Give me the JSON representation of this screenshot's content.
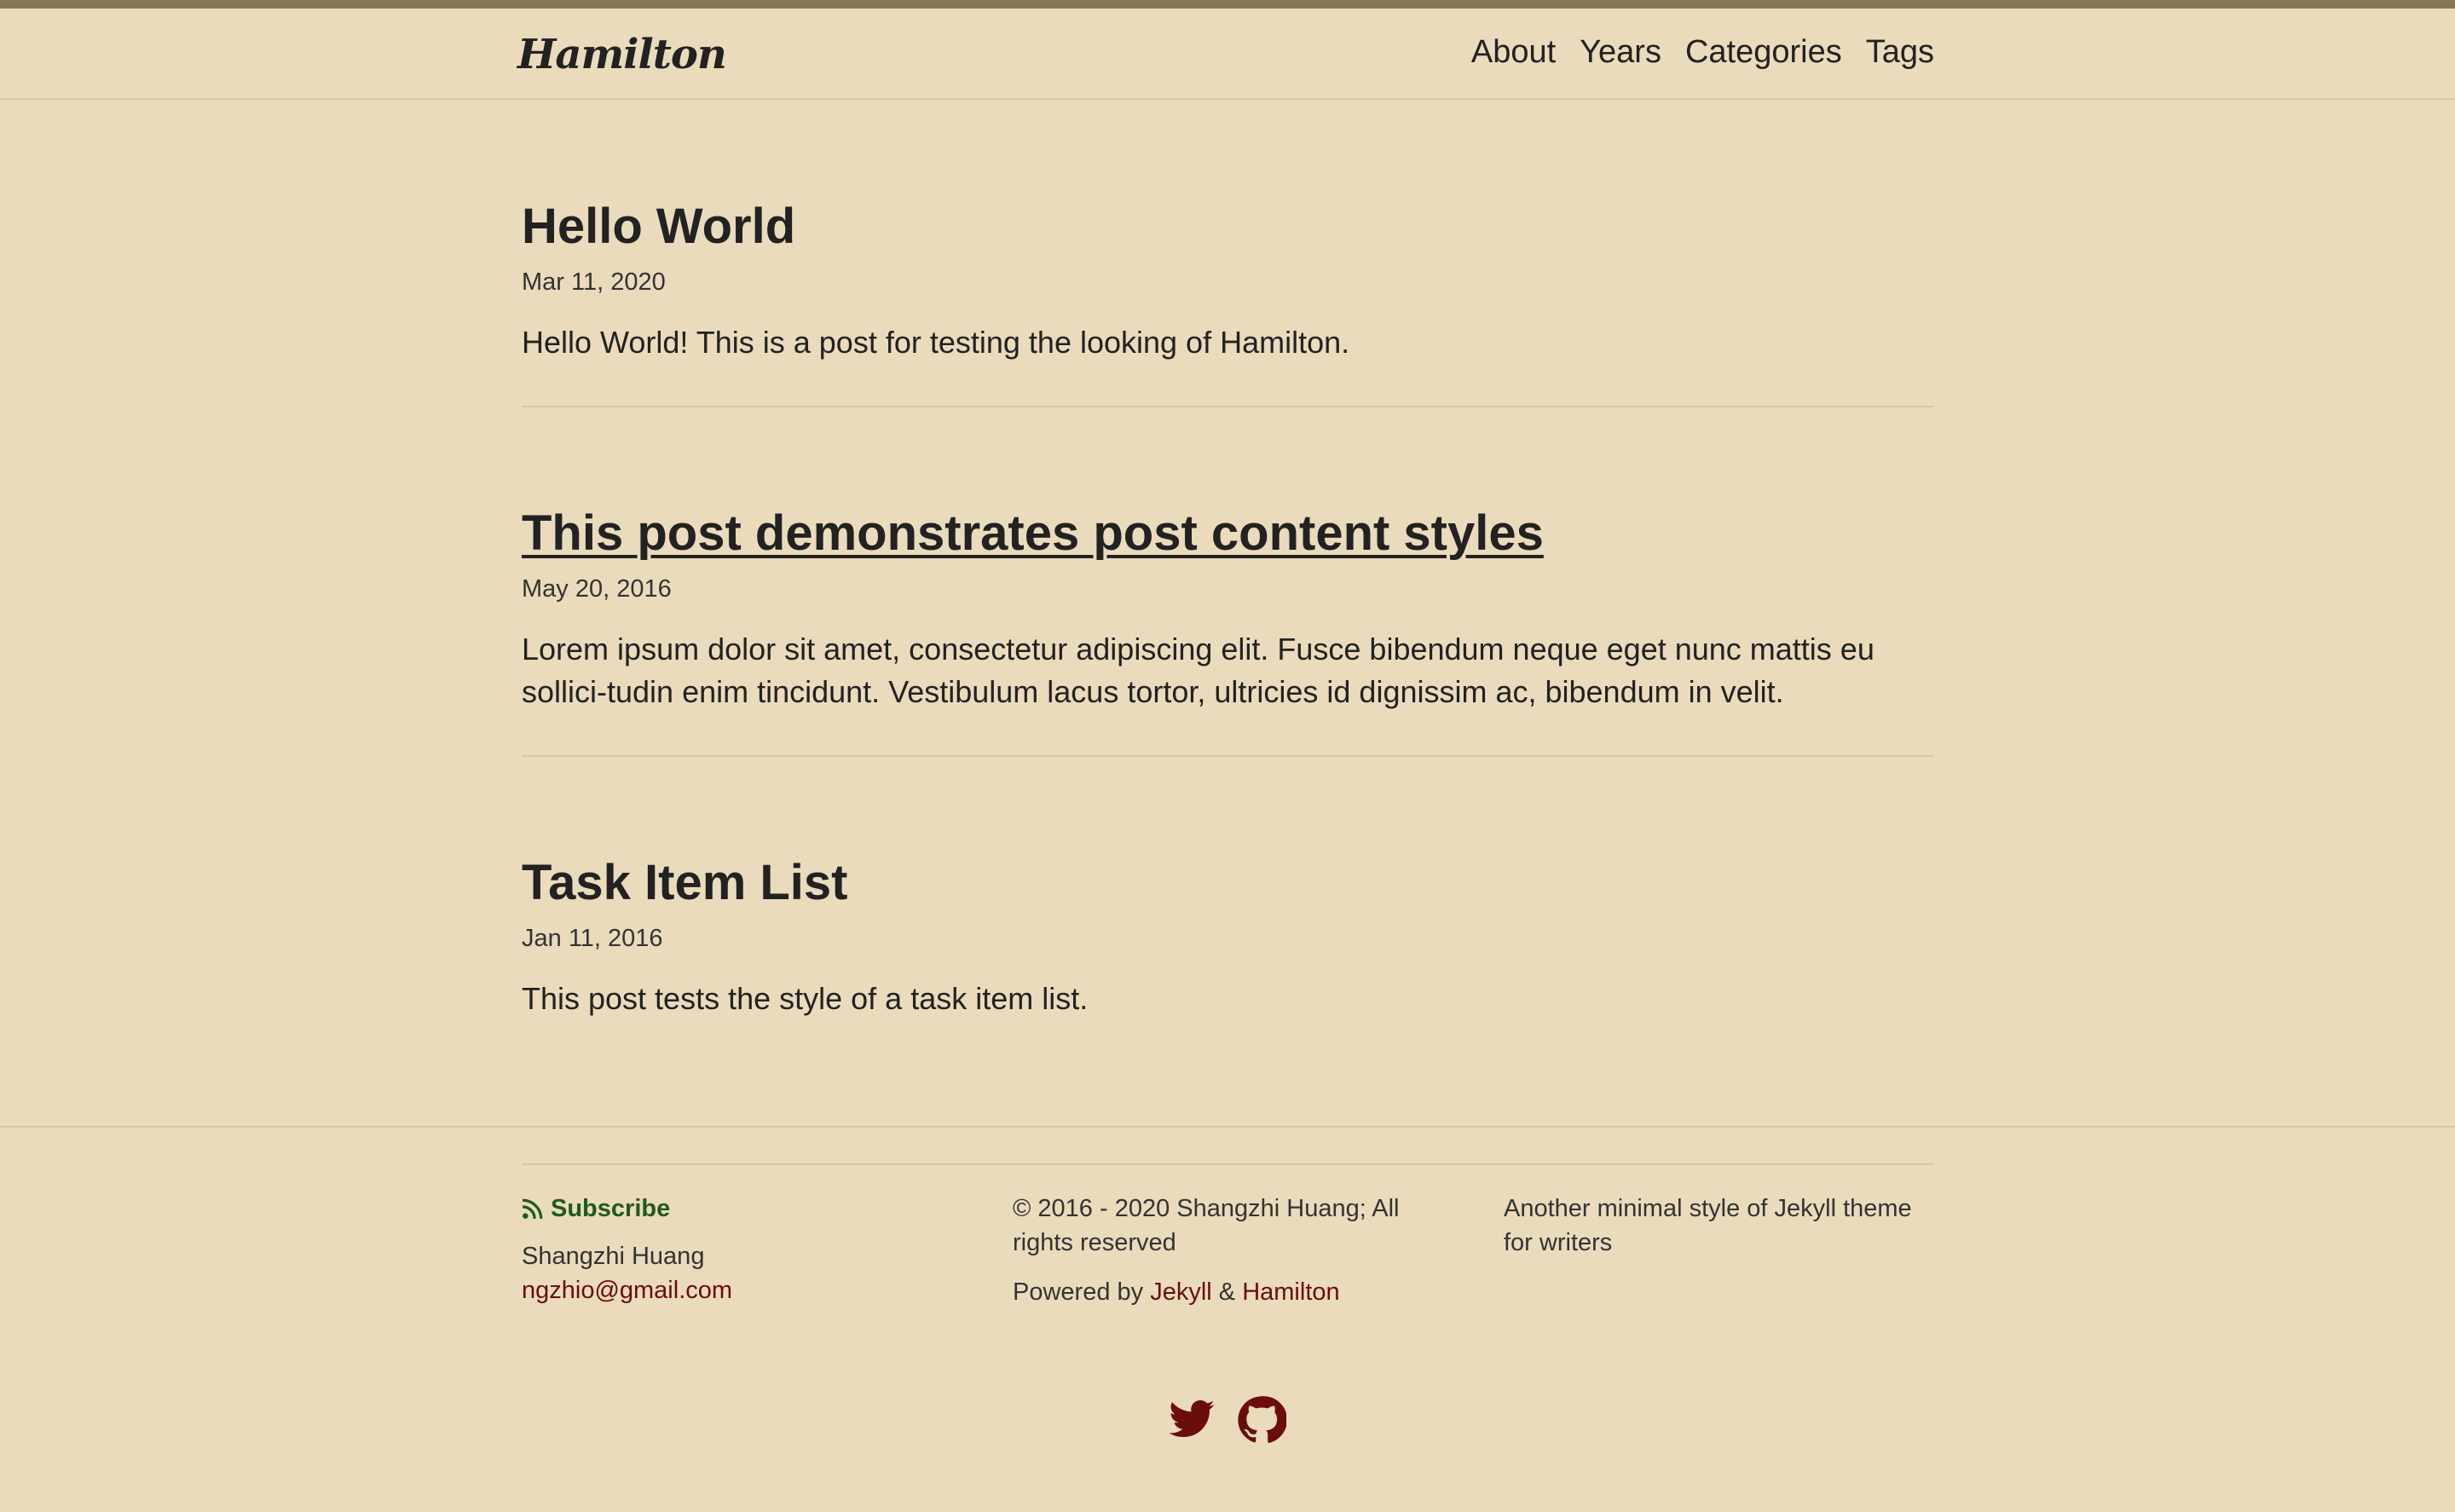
{
  "site": {
    "title": "Hamilton"
  },
  "nav": {
    "items": [
      "About",
      "Years",
      "Categories",
      "Tags"
    ]
  },
  "posts": [
    {
      "title": "Hello World",
      "date": "Mar 11, 2020",
      "excerpt": "Hello World! This is a post for testing the looking of Hamilton."
    },
    {
      "title": "This post demonstrates post content styles",
      "date": "May 20, 2016",
      "excerpt": "Lorem ipsum dolor sit amet, consectetur adipiscing elit. Fusce bibendum neque eget nunc mattis eu sollici-­tudin enim tincidunt. Vestibulum lacus tortor, ultricies id dignissim ac, bibendum in velit."
    },
    {
      "title": "Task Item List",
      "date": "Jan 11, 2016",
      "excerpt": "This post tests the style of a task item list."
    }
  ],
  "footer": {
    "subscribe": "Subscribe",
    "author": "Shangzhi Huang",
    "email": "ngzhio@gmail.com",
    "copyright": "© 2016 - 2020 Shangzhi Huang; All rights reserved",
    "powered_prefix": "Powered by",
    "jekyll": "Jekyll",
    "amp": "&",
    "hamilton": "Hamilton",
    "description": "Another minimal style of Jekyll theme for writers"
  },
  "icons": {
    "rss": "rss-icon",
    "twitter": "twitter-icon",
    "github": "github-icon"
  },
  "colors": {
    "background": "#eadbbc",
    "topbar": "#857753",
    "accent": "#6b0d0d",
    "subscribe": "#1f5a1f"
  }
}
